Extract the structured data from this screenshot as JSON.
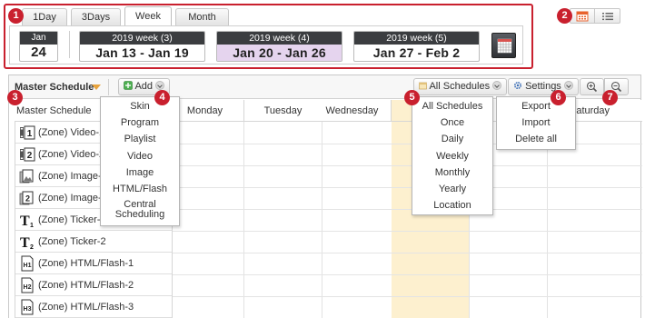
{
  "badges": [
    "1",
    "2",
    "3",
    "4",
    "5",
    "6",
    "7"
  ],
  "view_tabs": [
    {
      "label": "1Day",
      "active": false
    },
    {
      "label": "3Days",
      "active": false
    },
    {
      "label": "Week",
      "active": true
    },
    {
      "label": "Month",
      "active": false
    }
  ],
  "today_card": {
    "month": "Jan",
    "day": "24"
  },
  "weeks": [
    {
      "header": "2019 week (3)",
      "range": "Jan 13 - Jan 19",
      "current": false
    },
    {
      "header": "2019 week (4)",
      "range": "Jan 20 - Jan 26",
      "current": true
    },
    {
      "header": "2019 week (5)",
      "range": "Jan 27 - Feb 2",
      "current": false
    }
  ],
  "view_toggle": {
    "calendar_icon": "calendar-icon",
    "list_icon": "list-icon"
  },
  "toolbar": {
    "master_schedule": "Master Schedule",
    "add_label": "Add",
    "all_schedules_label": "All Schedules",
    "settings_label": "Settings",
    "zoom_in_icon": "zoom-in-icon",
    "zoom_out_icon": "zoom-out-icon"
  },
  "grid": {
    "zone_column_header": "Master Schedule",
    "day_headers": [
      "",
      "Monday",
      "Tuesday",
      "Wednesday",
      "",
      "",
      "Saturday"
    ],
    "today_column": 4
  },
  "zones": [
    {
      "label": "(Zone) Video-1",
      "icon": "video-zone-1-icon"
    },
    {
      "label": "(Zone) Video-2",
      "icon": "video-zone-2-icon"
    },
    {
      "label": "(Zone) Image-",
      "icon": "image-zone-1-icon"
    },
    {
      "label": "(Zone) Image-",
      "icon": "image-zone-2-icon"
    },
    {
      "label": "(Zone) Ticker-1",
      "icon": "ticker-zone-1-icon"
    },
    {
      "label": "(Zone) Ticker-2",
      "icon": "ticker-zone-2-icon"
    },
    {
      "label": "(Zone) HTML/Flash-1",
      "icon": "html-zone-1-icon"
    },
    {
      "label": "(Zone) HTML/Flash-2",
      "icon": "html-zone-2-icon"
    },
    {
      "label": "(Zone) HTML/Flash-3",
      "icon": "html-zone-3-icon"
    }
  ],
  "add_menu": [
    "Skin",
    "Program",
    "Playlist",
    "Video",
    "Image",
    "HTML/Flash",
    "Central Scheduling"
  ],
  "schedule_menu": [
    "All Schedules",
    "Once",
    "Daily",
    "Weekly",
    "Monthly",
    "Yearly",
    "Location"
  ],
  "settings_menu": [
    "Export",
    "Import",
    "Delete all"
  ],
  "colors": {
    "badge": "#c9202e",
    "current_week": "#e5d4ee",
    "today_column": "#fdf0cf",
    "calendar_accent": "#e8622d"
  }
}
